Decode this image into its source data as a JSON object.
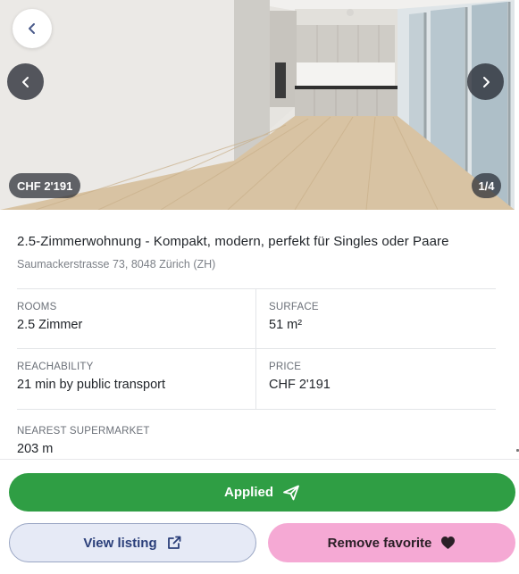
{
  "gallery": {
    "price_badge": "CHF 2'191",
    "counter": "1/4",
    "icons": {
      "back": "chevron-left-icon",
      "prev": "chevron-left-icon",
      "next": "chevron-right-icon"
    }
  },
  "listing": {
    "title": "2.5-Zimmerwohnung - Kompakt, modern, perfekt für Singles oder Paare",
    "address": "Saumackerstrasse 73, 8048 Zürich (ZH)"
  },
  "details": {
    "rooms": {
      "label": "ROOMS",
      "value": "2.5 Zimmer"
    },
    "surface": {
      "label": "SURFACE",
      "value": "51 m²"
    },
    "reachability": {
      "label": "REACHABILITY",
      "value": "21 min by public transport"
    },
    "price": {
      "label": "PRICE",
      "value": "CHF 2'191"
    },
    "supermarket": {
      "label": "NEAREST SUPERMARKET",
      "value": "203 m"
    }
  },
  "actions": {
    "applied_label": "Applied",
    "applied_icon": "send-icon",
    "view_label": "View listing",
    "view_icon": "external-link-icon",
    "favorite_label": "Remove favorite",
    "favorite_icon": "heart-icon"
  },
  "colors": {
    "applied_bg": "#2f9e44",
    "view_bg": "#e6eaf6",
    "favorite_bg": "#f5a9d4",
    "overlay_pill": "#282c34"
  }
}
